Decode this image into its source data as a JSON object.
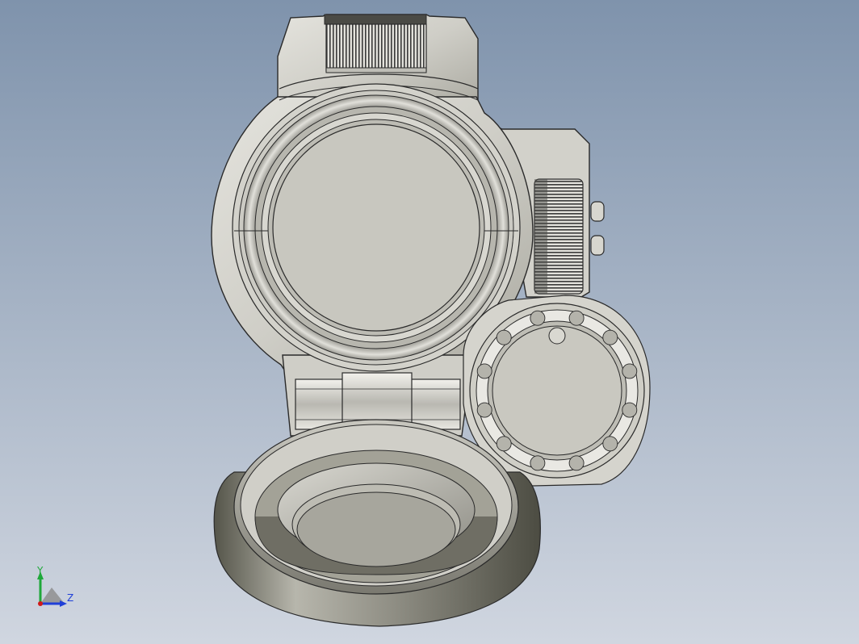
{
  "viewport": {
    "background_top": "#7f93ac",
    "background_bottom": "#d0d6e0"
  },
  "model": {
    "body_color": "#d6d5cf",
    "body_edge": "#2a2a2a",
    "lens_color": "#c9c8c0",
    "cap_inner_color": "#a9a89f",
    "knurl_dark": "#3a3a3a"
  },
  "triad": {
    "y_label": "Y",
    "z_label": "Z",
    "y_color": "#1fa83a",
    "z_color": "#1f3fd8",
    "x_color": "#d01a1a"
  }
}
